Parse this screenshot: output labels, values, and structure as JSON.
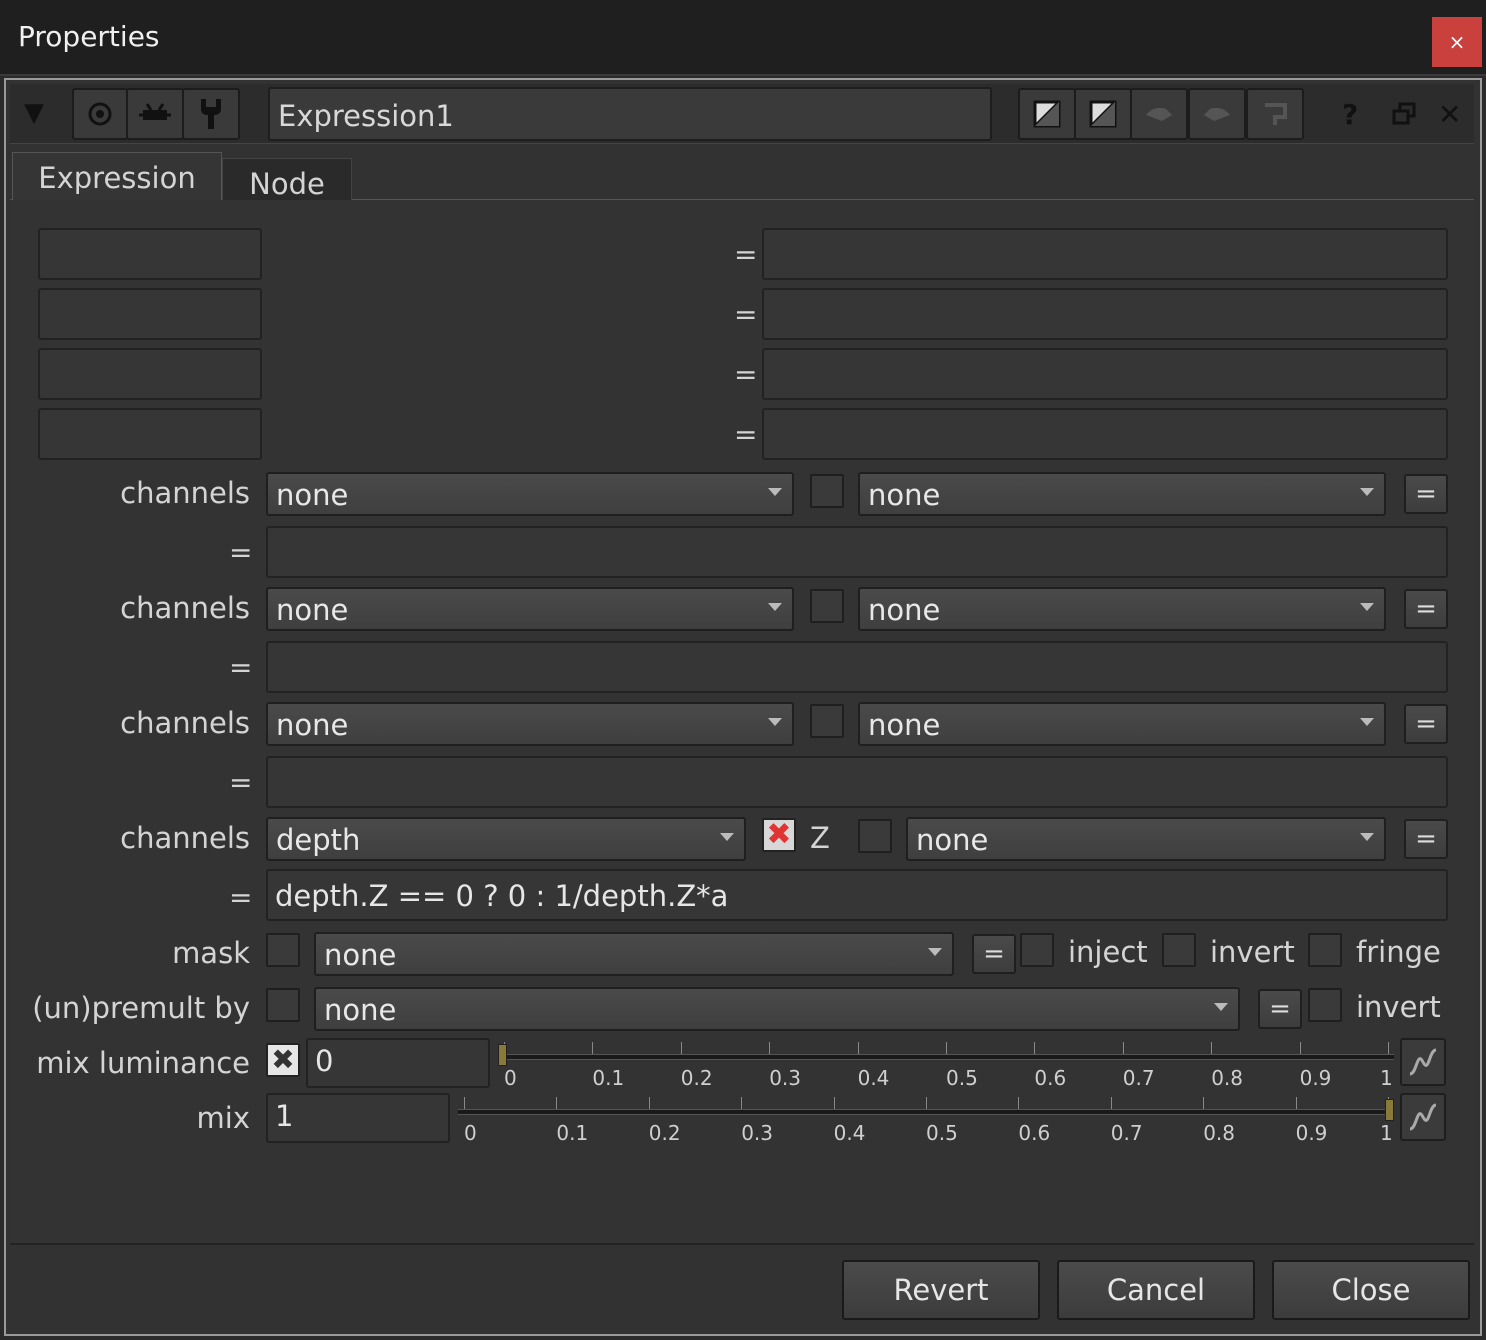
{
  "window": {
    "title": "Properties",
    "close_glyph": "×"
  },
  "toolbar": {
    "node_name": "Expression1",
    "icons": [
      "collapse-arrow-icon",
      "viewer-icon",
      "input-icon",
      "settings-wrench-icon",
      "color-swatch-icon",
      "color-swatch-icon",
      "undo-icon",
      "redo-icon",
      "revert-icon",
      "help-icon",
      "float-icon",
      "close-icon"
    ],
    "help_glyph": "?",
    "close_glyph": "✕"
  },
  "tabs": [
    {
      "label": "Expression"
    },
    {
      "label": "Node"
    }
  ],
  "temp_rows": [
    {
      "name": "",
      "eq": "=",
      "value": ""
    },
    {
      "name": "",
      "eq": "=",
      "value": ""
    },
    {
      "name": "",
      "eq": "=",
      "value": ""
    },
    {
      "name": "",
      "eq": "=",
      "value": ""
    }
  ],
  "channel_rows": [
    {
      "label": "channels",
      "channel": "none",
      "layer": "none",
      "eq_btn": "=",
      "eq": "=",
      "expr": ""
    },
    {
      "label": "channels",
      "channel": "none",
      "layer": "none",
      "eq_btn": "=",
      "eq": "=",
      "expr": ""
    },
    {
      "label": "channels",
      "channel": "none",
      "layer": "none",
      "eq_btn": "=",
      "eq": "=",
      "expr": ""
    },
    {
      "label": "channels",
      "channel": "depth",
      "component": "Z",
      "component_checked": true,
      "layer": "none",
      "eq_btn": "=",
      "eq": "=",
      "expr": "depth.Z == 0 ? 0 : 1/depth.Z*a"
    }
  ],
  "mask": {
    "label": "mask",
    "value": "none",
    "eq_btn": "=",
    "inject": "inject",
    "invert": "invert",
    "fringe": "fringe"
  },
  "premult": {
    "label": "(un)premult by",
    "value": "none",
    "eq_btn": "=",
    "invert": "invert"
  },
  "mix_luminance": {
    "label": "mix luminance",
    "enabled": true,
    "value": "0",
    "ticks": [
      "0",
      "0.1",
      "0.2",
      "0.3",
      "0.4",
      "0.5",
      "0.6",
      "0.7",
      "0.8",
      "0.9",
      "1"
    ]
  },
  "mix": {
    "label": "mix",
    "value": "1",
    "ticks": [
      "0",
      "0.1",
      "0.2",
      "0.3",
      "0.4",
      "0.5",
      "0.6",
      "0.7",
      "0.8",
      "0.9",
      "1"
    ]
  },
  "buttons": {
    "revert": "Revert",
    "cancel": "Cancel",
    "close": "Close"
  },
  "colors": {
    "background": "#333333",
    "close_red": "#c9403c",
    "checkbox_red": "#e03434",
    "slider_handle": "#8a7a3a"
  }
}
